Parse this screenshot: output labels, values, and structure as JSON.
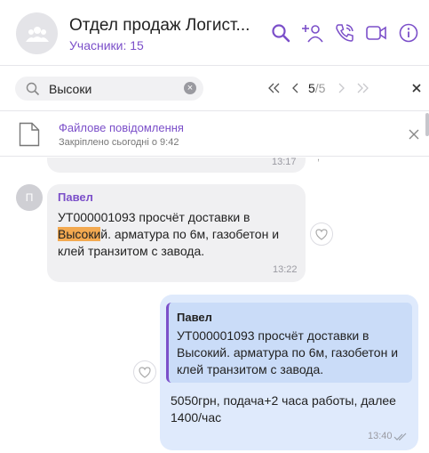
{
  "header": {
    "title": "Отдел продаж Логист...",
    "participants": "Учасники: 15",
    "icons": [
      "search-icon",
      "add-member-icon",
      "voice-call-icon",
      "video-call-icon",
      "info-icon"
    ],
    "accent": "#7b4fc9"
  },
  "search": {
    "value": "Высоки",
    "counter_current": "5",
    "counter_total": "/5"
  },
  "pinned": {
    "title": "Файлове повідомлення",
    "subtitle": "Закріплено сьогодні о 9:42"
  },
  "messages": [
    {
      "time": "13:17"
    },
    {
      "avatar_letter": "П",
      "sender": "Павел",
      "line1": "УТ000001093 просчёт доставки в",
      "highlight": "Высоки",
      "line2_rest": "й. арматура по 6м, газобетон и",
      "line3": "клей транзитом с завода.",
      "time": "13:22"
    },
    {
      "quote_sender": "Павел",
      "quote_line1": "УТ000001093 просчёт доставки в",
      "quote_line2": "Высокий. арматура по 6м, газобетон и",
      "quote_line3": "клей транзитом с завода.",
      "line1": "5050грн, подача+2 часа работы, далее",
      "line2": "1400/час",
      "time": "13:40"
    }
  ]
}
